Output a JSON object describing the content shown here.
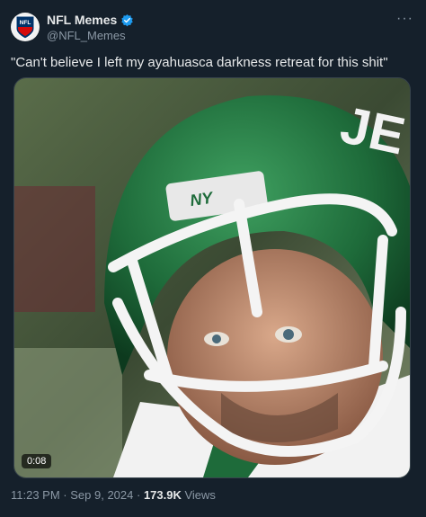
{
  "author": {
    "display_name": "NFL Memes",
    "handle": "@NFL_Memes",
    "avatar_icon": "nfl-shield-logo",
    "avatar_text": "NFL"
  },
  "more_icon": "ellipsis-icon",
  "tweet": {
    "text": "\"Can't believe I left my ayahuasca darkness retreat for this shit\""
  },
  "media": {
    "helmet_text": "NY",
    "duration": "0:08"
  },
  "meta": {
    "time": "11:23 PM",
    "sep1": " · ",
    "date": "Sep 9, 2024",
    "sep2": " · ",
    "views_count": "173.9K",
    "views_label": " Views"
  },
  "colors": {
    "background": "#15202b",
    "text": "#e7e9ea",
    "secondary": "#8b98a5",
    "verified": "#1d9bf0",
    "helmet_green": "#1e6b3a"
  }
}
